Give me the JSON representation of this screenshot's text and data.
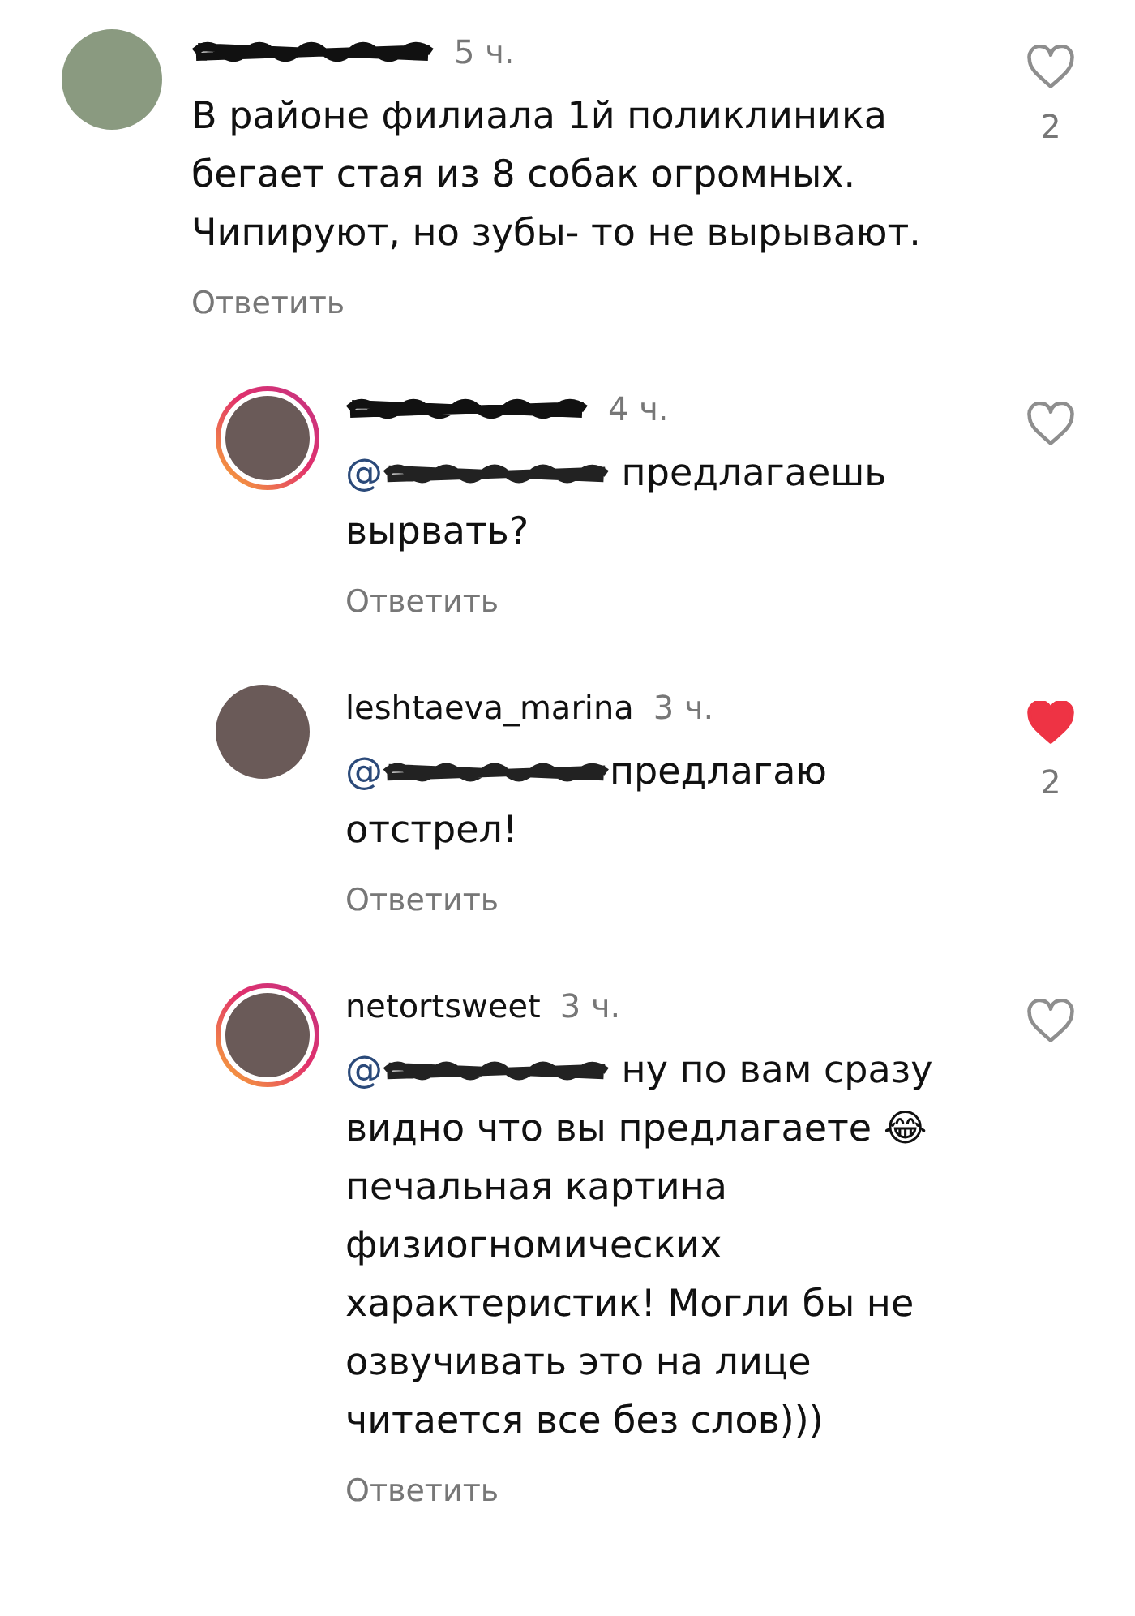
{
  "comments": [
    {
      "time": "5 ч.",
      "text": "В районе филиала 1й поликлиника бегает стая из 8 собак огромных. Чипируют, но зубы- то не вырывают.",
      "reply_label": "Ответить",
      "liked": false,
      "like_count": "2",
      "story_ring": false,
      "children": [
        {
          "time": "4 ч.",
          "mention": "@",
          "text": " предлагаешь вырвать?",
          "reply_label": "Ответить",
          "liked": false,
          "story_ring": true
        },
        {
          "username": "leshtaeva_marina",
          "time": "3 ч.",
          "mention": "@",
          "text": "предлагаю отстрел!",
          "reply_label": "Ответить",
          "liked": true,
          "like_count": "2",
          "story_ring": false
        },
        {
          "username": "netortsweet",
          "time": "3 ч.",
          "mention": "@",
          "text": " ну по вам сразу видно что вы предлагаете 😂 печальная картина физиогномических характеристик! Могли бы не озвучивать это на лице читается все без слов)))",
          "reply_label": "Ответить",
          "liked": false,
          "story_ring": true
        }
      ]
    }
  ]
}
